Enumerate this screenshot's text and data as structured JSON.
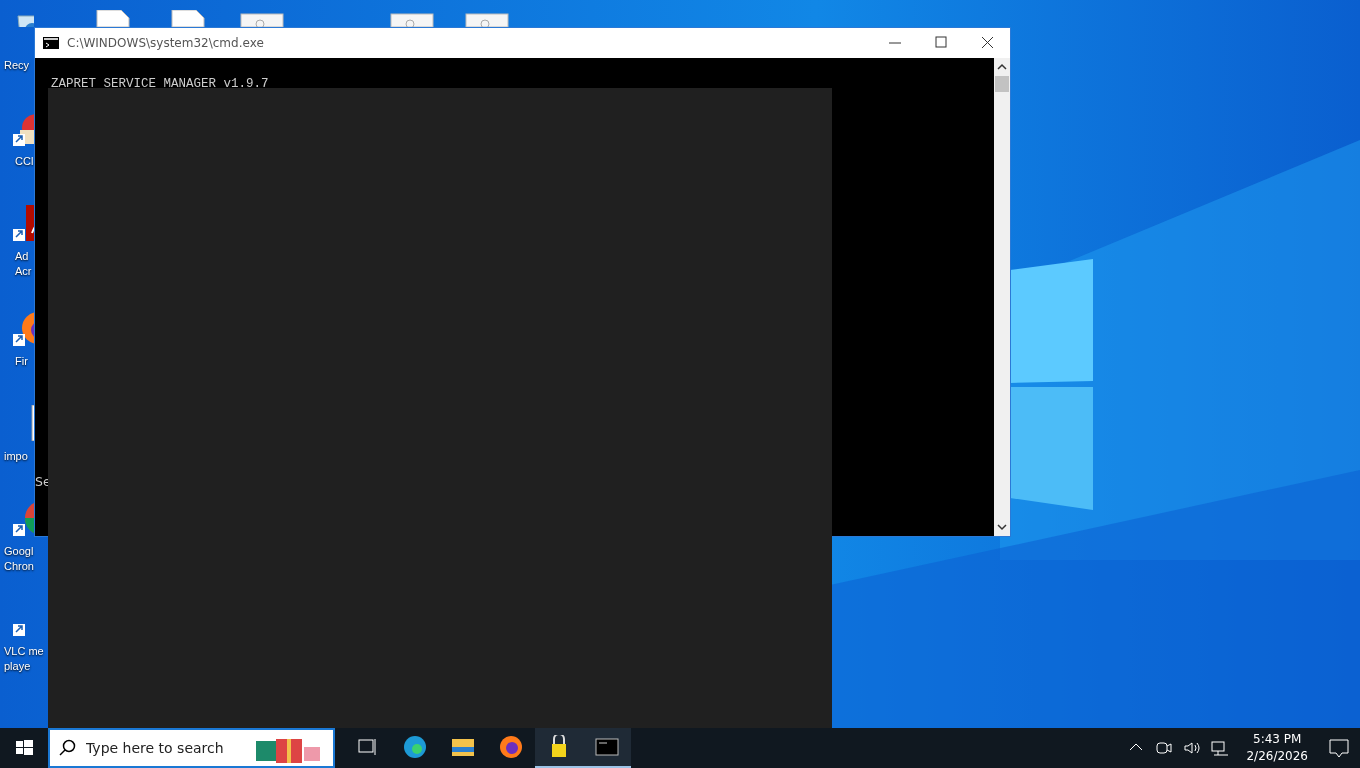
{
  "desktop_icons_top": [
    {
      "kind": "file"
    },
    {
      "kind": "file"
    },
    {
      "kind": "gear"
    },
    {
      "kind": "gear"
    },
    {
      "kind": "gear"
    }
  ],
  "desktop_icons": [
    {
      "kind": "recycle",
      "lines": [
        "Recy"
      ]
    },
    {
      "kind": "ccleaner",
      "lines": [
        "CCl"
      ]
    },
    {
      "kind": "acrobat",
      "lines": [
        "Ad",
        "Acr"
      ]
    },
    {
      "kind": "firefox",
      "lines": [
        "Fir"
      ]
    },
    {
      "kind": "image",
      "lines": [
        "impo"
      ]
    },
    {
      "kind": "chrome",
      "lines": [
        "Googl",
        "Chron"
      ]
    },
    {
      "kind": "vlc",
      "lines": [
        "VLC me",
        "playe"
      ]
    }
  ],
  "window": {
    "title": "C:\\WINDOWS\\system32\\cmd.exe",
    "console_lines": [
      "ZAPRET SERVICE MANAGER v1.9.7"
    ],
    "side_text": "Se"
  },
  "taskbar": {
    "search": {
      "placeholder": "Type here to search"
    },
    "apps": [
      {
        "kind": "taskview",
        "running": false
      },
      {
        "kind": "edge",
        "running": false
      },
      {
        "kind": "explorer",
        "running": false
      },
      {
        "kind": "firefox",
        "running": false
      },
      {
        "kind": "lock",
        "running": true
      },
      {
        "kind": "cmd",
        "running": true
      }
    ],
    "time": "5:43 PM",
    "date": "2/26/2026"
  }
}
